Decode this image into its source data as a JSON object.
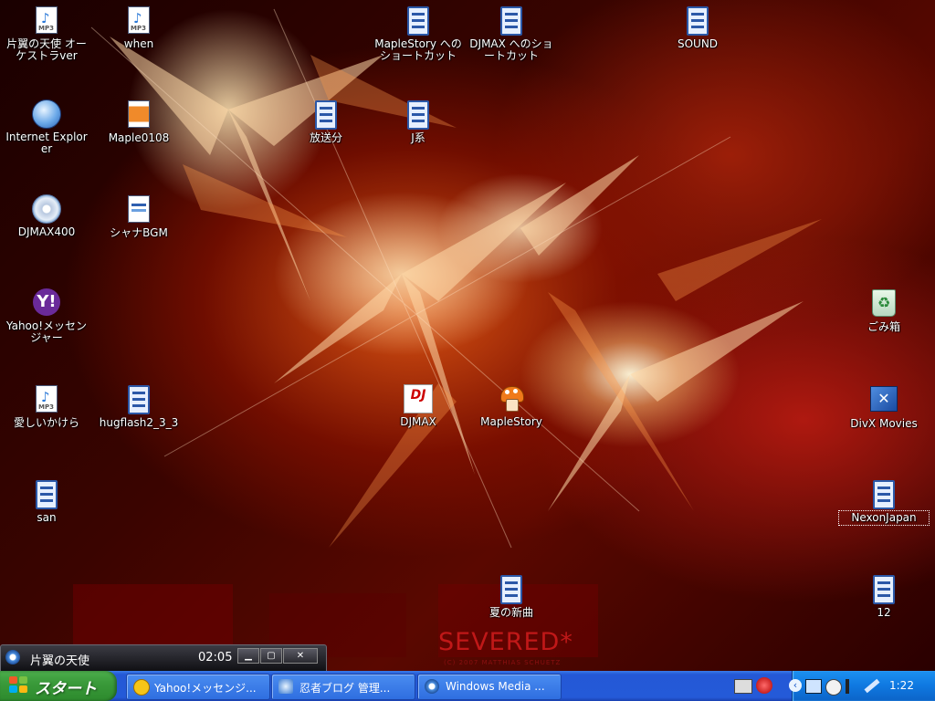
{
  "desktop": {
    "wallpaper_text": "SEVERED*",
    "wallpaper_subtext": "(C) 2007 MATTHIAS SCHUETZ",
    "icons": [
      {
        "label": "片翼の天使 オーケストラver",
        "icon": "mp3-file-icon"
      },
      {
        "label": "when",
        "icon": "mp3-file-icon"
      },
      {
        "label": "MapleStory へのショートカット",
        "icon": "file-shortcut-icon"
      },
      {
        "label": "DJMAX へのショートカット",
        "icon": "file-shortcut-icon"
      },
      {
        "label": "SOUND",
        "icon": "file-icon"
      },
      {
        "label": "Internet Explorer",
        "icon": "internet-explorer-icon"
      },
      {
        "label": "Maple0108",
        "icon": "image-file-icon"
      },
      {
        "label": "放送分",
        "icon": "file-icon"
      },
      {
        "label": "J系",
        "icon": "file-icon"
      },
      {
        "label": "DJMAX400",
        "icon": "cd-icon"
      },
      {
        "label": "シャナBGM",
        "icon": "media-file-icon"
      },
      {
        "label": "Yahoo!メッセンジャー",
        "icon": "yahoo-messenger-icon"
      },
      {
        "label": "ごみ箱",
        "icon": "recycle-bin-icon"
      },
      {
        "label": "愛しいかけら",
        "icon": "mp3-file-icon"
      },
      {
        "label": "hugflash2_3_3",
        "icon": "file-icon"
      },
      {
        "label": "DJMAX",
        "icon": "djmax-icon"
      },
      {
        "label": "MapleStory",
        "icon": "maplestory-icon"
      },
      {
        "label": "DivX Movies",
        "icon": "divx-icon"
      },
      {
        "label": "san",
        "icon": "file-icon"
      },
      {
        "label": "NexonJapan",
        "icon": "file-icon"
      },
      {
        "label": "夏の新曲",
        "icon": "file-icon"
      },
      {
        "label": "12",
        "icon": "file-icon"
      }
    ]
  },
  "media_player_mini": {
    "track_title": "片翼の天使",
    "time": "02:05",
    "buttons": [
      "minimize",
      "restore",
      "close"
    ]
  },
  "taskbar": {
    "start_label": "スタート",
    "tasks": [
      {
        "label": "Yahoo!メッセンジ...",
        "icon": "yahoo-messenger-icon"
      },
      {
        "label": "忍者ブログ 管理...",
        "icon": "internet-explorer-icon"
      },
      {
        "label": "Windows Media ...",
        "icon": "windows-media-player-icon"
      }
    ],
    "tray": {
      "clock": "1:22",
      "icons": [
        "keyboard-icon",
        "security-alert-icon",
        "expand-tray-icon",
        "network-icon",
        "messenger-icon",
        "signal-icon",
        "pen-icon"
      ]
    }
  },
  "colors": {
    "taskbar_blue": "#245ad8",
    "start_green": "#3a9a3a",
    "tray_blue": "#0f78e0",
    "wallpaper_red": "#c01818"
  }
}
